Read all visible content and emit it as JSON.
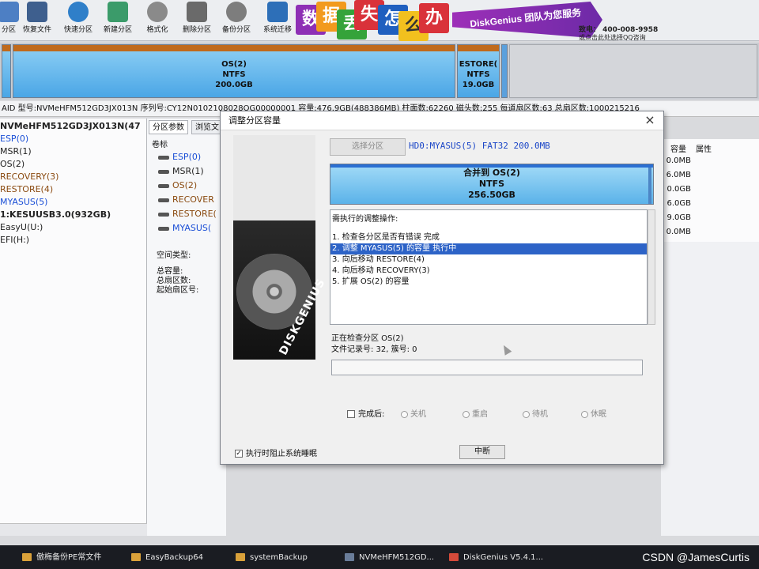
{
  "toolbar": {
    "buttons": [
      {
        "label": "分区",
        "icon": "partition-icon"
      },
      {
        "label": "恢复文件",
        "icon": "recover-files-icon"
      },
      {
        "label": "快速分区",
        "icon": "quick-partition-icon"
      },
      {
        "label": "新建分区",
        "icon": "new-partition-icon"
      },
      {
        "label": "格式化",
        "icon": "format-icon"
      },
      {
        "label": "删除分区",
        "icon": "delete-partition-icon"
      },
      {
        "label": "备份分区",
        "icon": "backup-partition-icon"
      },
      {
        "label": "系统迁移",
        "icon": "system-migration-icon"
      }
    ]
  },
  "banner": {
    "chars": [
      "数",
      "据",
      "丢",
      "失",
      "怎",
      "么",
      "办"
    ],
    "brand_text": "DiskGenius 团队为您服务",
    "phone": "致电： 400-008-9958",
    "qq": "或点击此处选择QQ咨询",
    "colors": {
      "purple": "#8e2fb5",
      "orange": "#f29a1e",
      "blue": "#1f5fbf",
      "red": "#d9323a",
      "green": "#35a33a"
    }
  },
  "diskmap": {
    "segments": [
      {
        "name": "OS(2)",
        "fs": "NTFS",
        "size": "200.0GB"
      },
      {
        "name": "ESTORE(",
        "fs": "NTFS",
        "size": "19.0GB"
      }
    ]
  },
  "diskinfo": "AID  型号:NVMeHFM512GD3JX013N  序列号:CY12N0102108028OG00000001   容量:476.9GB(488386MB)  柱面数:62260  磁头数:255  每道扇区数:63  总扇区数:1000215216",
  "tree": [
    {
      "label": "NVMeHFM512GD3JX013N(47",
      "style": "disk"
    },
    {
      "label": "ESP(0)",
      "style": "blue"
    },
    {
      "label": "MSR(1)",
      "style": "dark"
    },
    {
      "label": "OS(2)",
      "style": "dark"
    },
    {
      "label": "RECOVERY(3)",
      "style": "brown"
    },
    {
      "label": "RESTORE(4)",
      "style": "brown"
    },
    {
      "label": "MYASUS(5)",
      "style": "blue"
    },
    {
      "label": "1:KESUUSB3.0(932GB)",
      "style": "disk"
    },
    {
      "label": "EasyU(U:)",
      "style": "dark"
    },
    {
      "label": "EFI(H:)",
      "style": "dark"
    }
  ],
  "mid": {
    "tabs": [
      "分区参数",
      "浏览文"
    ],
    "header": "卷标",
    "items": [
      {
        "label": "ESP(0)",
        "color": "#1b4fd6"
      },
      {
        "label": "MSR(1)",
        "color": "#222222"
      },
      {
        "label": "OS(2)",
        "color": "#8a4a10"
      },
      {
        "label": "RECOVER",
        "color": "#8a4a10"
      },
      {
        "label": "RESTORE(",
        "color": "#8a4a10"
      },
      {
        "label": "MYASUS(",
        "color": "#1b4fd6"
      }
    ],
    "space_type": "空间类型:",
    "kv": [
      "总容量:",
      "总扇区数:",
      "起始扇区号:"
    ]
  },
  "rightcols": {
    "headers": [
      "容量",
      "属性"
    ],
    "values": [
      "0.0MB",
      "6.0MB",
      "0.0GB",
      "6.0GB",
      "9.0GB",
      "0.0MB"
    ]
  },
  "dialog": {
    "title": "调整分区容量",
    "close": "×",
    "select_button": "选择分区",
    "target": "HD0:MYASUS(5) FAT32 200.0MB",
    "merged": {
      "title": "合并到 OS(2)",
      "fs": "NTFS",
      "size": "256.50GB"
    },
    "hdd_label": "DISKGENIUS",
    "ops_title": "需执行的调整操作:",
    "ops": [
      "1. 检查各分区是否有错误    完成",
      "2. 调整 MYASUS(5) 的容量    执行中",
      "3. 向后移动 RESTORE(4)",
      "4. 向后移动 RECOVERY(3)",
      "5. 扩展 OS(2) 的容量"
    ],
    "selected_op": 1,
    "status_line1": "正在检查分区 OS(2)",
    "status_line2": "文件记录号: 32, 簇号: 0",
    "progress": 0.0,
    "after_label": "完成后:",
    "after_options": [
      "关机",
      "重启",
      "待机",
      "休眠"
    ],
    "prevent_sleep_label": "执行时阻止系统睡眠",
    "abort_button": "中断"
  },
  "taskbar": {
    "items": [
      {
        "label": "傲梅备份PE常文件",
        "icon": "folder-icon"
      },
      {
        "label": "EasyBackup64",
        "icon": "folder-icon"
      },
      {
        "label": "systemBackup",
        "icon": "folder-icon"
      },
      {
        "label": "NVMeHFM512GD...",
        "icon": "disk-icon"
      },
      {
        "label": "DiskGenius V5.4.1...",
        "icon": "diskgenius-icon"
      }
    ],
    "watermark": "CSDN @JamesCurtis"
  }
}
